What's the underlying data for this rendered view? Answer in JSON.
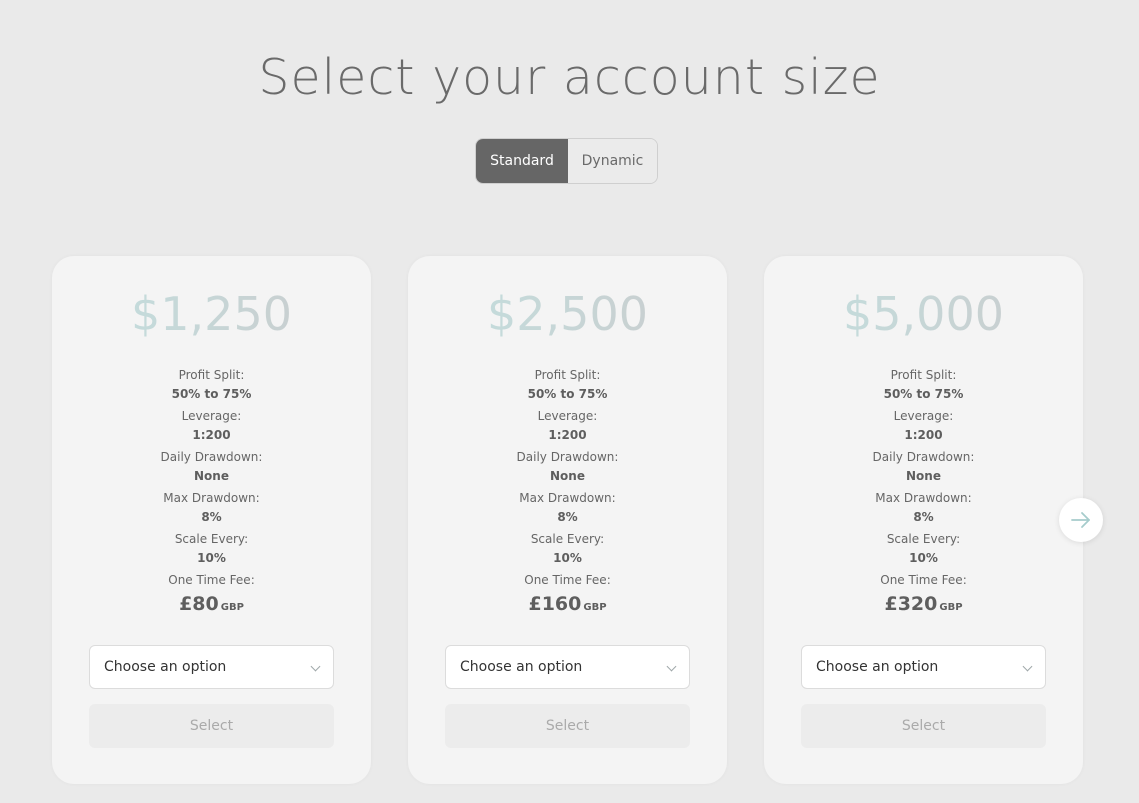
{
  "header": {
    "title": "Select your account size"
  },
  "toggle": {
    "options": [
      {
        "label": "Standard",
        "active": true
      },
      {
        "label": "Dynamic",
        "active": false
      }
    ]
  },
  "cards": [
    {
      "price": "$1,250",
      "specs": [
        {
          "label": "Profit Split:",
          "value": "50% to 75%"
        },
        {
          "label": "Leverage:",
          "value": "1:200"
        },
        {
          "label": "Daily Drawdown:",
          "value": "None"
        },
        {
          "label": "Max Drawdown:",
          "value": "8%"
        },
        {
          "label": "Scale Every:",
          "value": "10%"
        }
      ],
      "fee_label": "One Time Fee:",
      "fee_amount": "£80",
      "fee_currency": "GBP",
      "select_placeholder": "Choose an option",
      "select_button": "Select"
    },
    {
      "price": "$2,500",
      "specs": [
        {
          "label": "Profit Split:",
          "value": "50% to 75%"
        },
        {
          "label": "Leverage:",
          "value": "1:200"
        },
        {
          "label": "Daily Drawdown:",
          "value": "None"
        },
        {
          "label": "Max Drawdown:",
          "value": "8%"
        },
        {
          "label": "Scale Every:",
          "value": "10%"
        }
      ],
      "fee_label": "One Time Fee:",
      "fee_amount": "£160",
      "fee_currency": "GBP",
      "select_placeholder": "Choose an option",
      "select_button": "Select"
    },
    {
      "price": "$5,000",
      "specs": [
        {
          "label": "Profit Split:",
          "value": "50% to 75%"
        },
        {
          "label": "Leverage:",
          "value": "1:200"
        },
        {
          "label": "Daily Drawdown:",
          "value": "None"
        },
        {
          "label": "Max Drawdown:",
          "value": "8%"
        },
        {
          "label": "Scale Every:",
          "value": "10%"
        }
      ],
      "fee_label": "One Time Fee:",
      "fee_amount": "£320",
      "fee_currency": "GBP",
      "select_placeholder": "Choose an option",
      "select_button": "Select"
    }
  ],
  "carousel": {
    "next_icon": "arrow-right-icon"
  },
  "colors": {
    "background": "#eaeaea",
    "card": "#f4f4f4",
    "toggle_active": "#666666",
    "price_gradient_start": "#c4dcdc",
    "price_gradient_end": "#c9cfd0",
    "arrow": "#a6cccc"
  }
}
